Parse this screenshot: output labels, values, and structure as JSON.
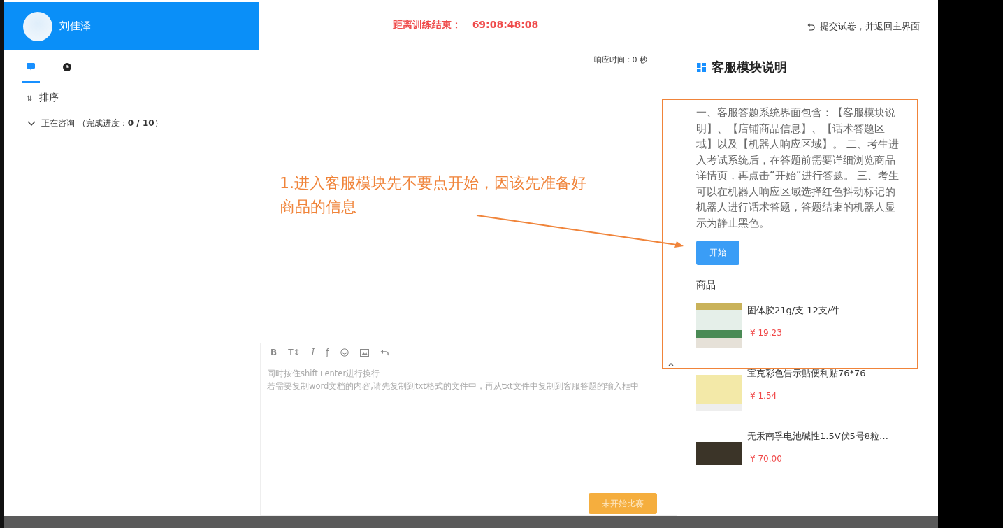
{
  "user": {
    "name": "刘佳泽"
  },
  "sidebar": {
    "tabs": [
      {
        "kind": "chat",
        "selected": true
      },
      {
        "kind": "history",
        "selected": false
      }
    ],
    "sort_icon": "⇅",
    "sort_label": "排序",
    "group": {
      "label": "正在咨询 （完成进度：**0 / 10**）",
      "expanded": true
    }
  },
  "timer": {
    "label": "距离训练结束：",
    "value": "69:08:48:08"
  },
  "submit_link": "提交试卷，并返回主界面",
  "response_time": "响应时间：0 秒",
  "editor": {
    "tools": [
      {
        "kind": "bold",
        "glyph": "B"
      },
      {
        "kind": "font-size",
        "glyph": "T↕"
      },
      {
        "kind": "italic",
        "glyph": "I"
      },
      {
        "kind": "clear-format",
        "glyph": "ƒ"
      },
      {
        "kind": "emoji"
      },
      {
        "kind": "image"
      },
      {
        "kind": "undo"
      }
    ],
    "placeholder_lines": [
      "同时按住shift+enter进行换行",
      "若需要复制word文档的内容,请先复制到txt格式的文件中，再从txt文件中复制到客服答题的输入框中"
    ],
    "button": {
      "label": "未开始比赛",
      "disabled": true
    }
  },
  "panel": {
    "title": "客服模块说明",
    "description": "一、客服答题系统界面包含：【客服模块说明】、【店铺商品信息】、【话术答题区域】以及【机器人响应区域】。 二、考生进入考试系统后，在答题前需要详细浏览商品详情页，再点击“开始”进行答题。 三、考生可以在机器人响应区域选择红色抖动标记的机器人进行话术答题，答题结束的机器人显示为静止黑色。",
    "start_button": "开始",
    "products_heading": "商品",
    "products": [
      {
        "name": "固体胶21g/支 12支/件",
        "price": "¥ 19.23",
        "kind": "glue"
      },
      {
        "name": "宝克彩色告示贴便利贴76*76",
        "price": "¥ 1.54",
        "kind": "notes"
      },
      {
        "name": "无汞南孚电池碱性1.5V伏5号8粒…",
        "price": "¥ 70.00",
        "kind": "battery"
      }
    ]
  },
  "annotation": {
    "lines": [
      "1.进入客服模块先不要点开始，因该先准备好",
      "商品的信息"
    ]
  }
}
